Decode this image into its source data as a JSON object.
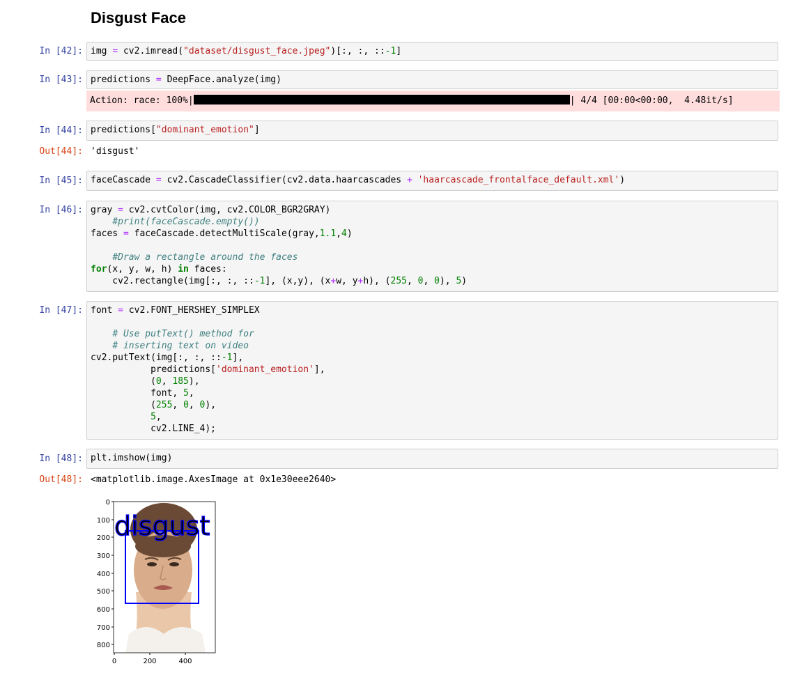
{
  "heading": "Disgust Face",
  "cells": {
    "c42": {
      "prompt": "In [42]:"
    },
    "c43": {
      "prompt": "In [43]:",
      "stderr_prefix": "Action: race: 100%|",
      "stderr_suffix": "| 4/4 [00:00<00:00,  4.48it/s]",
      "progress": 1.0
    },
    "c44": {
      "prompt": "In [44]:",
      "out_prompt": "Out[44]:",
      "out": "'disgust'"
    },
    "c45": {
      "prompt": "In [45]:"
    },
    "c46": {
      "prompt": "In [46]:"
    },
    "c47": {
      "prompt": "In [47]:"
    },
    "c48": {
      "prompt": "In [48]:",
      "out_prompt": "Out[48]:",
      "out": "<matplotlib.image.AxesImage at 0x1e30eee2640>"
    }
  },
  "code_tokens": {
    "c42": [
      [
        [
          "img ",
          ""
        ],
        [
          "=",
          "op"
        ],
        [
          " cv2.imread(",
          ""
        ],
        [
          "\"dataset/disgust_face.jpeg\"",
          "str"
        ],
        [
          ")[:, :, ::",
          ""
        ],
        [
          "-1",
          "num"
        ],
        [
          "]",
          ""
        ]
      ]
    ],
    "c43": [
      [
        [
          "predictions ",
          ""
        ],
        [
          "=",
          "op"
        ],
        [
          " DeepFace.analyze(img)",
          ""
        ]
      ]
    ],
    "c44": [
      [
        [
          "predictions[",
          ""
        ],
        [
          "\"dominant_emotion\"",
          "str"
        ],
        [
          "]",
          ""
        ]
      ]
    ],
    "c45": [
      [
        [
          "faceCascade ",
          ""
        ],
        [
          "=",
          "op"
        ],
        [
          " cv2.CascadeClassifier(cv2.data.haarcascades ",
          ""
        ],
        [
          "+",
          "op"
        ],
        [
          " ",
          ""
        ],
        [
          "'haarcascade_frontalface_default.xml'",
          "str"
        ],
        [
          ")",
          ""
        ]
      ]
    ],
    "c46": [
      [
        [
          "gray ",
          ""
        ],
        [
          "=",
          "op"
        ],
        [
          " cv2.cvtColor(img, cv2.COLOR_BGR2GRAY)",
          ""
        ]
      ],
      [
        [
          "    ",
          ""
        ],
        [
          "#print(faceCascade.empty())",
          "cm"
        ]
      ],
      [
        [
          "faces ",
          ""
        ],
        [
          "=",
          "op"
        ],
        [
          " faceCascade.detectMultiScale(gray,",
          ""
        ],
        [
          "1.1",
          "num"
        ],
        [
          ",",
          ""
        ],
        [
          "4",
          "num"
        ],
        [
          ")",
          ""
        ]
      ],
      [],
      [
        [
          "    ",
          ""
        ],
        [
          "#Draw a rectangle around the faces",
          "cm"
        ]
      ],
      [
        [
          "for",
          "kw"
        ],
        [
          "(x, y, w, h) ",
          ""
        ],
        [
          "in",
          "kw"
        ],
        [
          " faces:",
          ""
        ]
      ],
      [
        [
          "    cv2.rectangle(img[:, :, ::",
          ""
        ],
        [
          "-1",
          "num"
        ],
        [
          "], (x,y), (x",
          ""
        ],
        [
          "+",
          "op"
        ],
        [
          "w, y",
          ""
        ],
        [
          "+",
          "op"
        ],
        [
          "h), (",
          ""
        ],
        [
          "255",
          "num"
        ],
        [
          ", ",
          ""
        ],
        [
          "0",
          "num"
        ],
        [
          ", ",
          ""
        ],
        [
          "0",
          "num"
        ],
        [
          "), ",
          ""
        ],
        [
          "5",
          "num"
        ],
        [
          ")",
          ""
        ]
      ]
    ],
    "c47": [
      [
        [
          "font ",
          ""
        ],
        [
          "=",
          "op"
        ],
        [
          " cv2.FONT_HERSHEY_SIMPLEX",
          ""
        ]
      ],
      [],
      [
        [
          "    ",
          ""
        ],
        [
          "# Use putText() method for",
          "cm"
        ]
      ],
      [
        [
          "    ",
          ""
        ],
        [
          "# inserting text on video",
          "cm"
        ]
      ],
      [
        [
          "cv2.putText(img[:, :, ::",
          ""
        ],
        [
          "-1",
          "num"
        ],
        [
          "],",
          ""
        ]
      ],
      [
        [
          "           predictions[",
          ""
        ],
        [
          "'dominant_emotion'",
          "str"
        ],
        [
          "],",
          ""
        ]
      ],
      [
        [
          "           (",
          ""
        ],
        [
          "0",
          "num"
        ],
        [
          ", ",
          ""
        ],
        [
          "185",
          "num"
        ],
        [
          "),",
          ""
        ]
      ],
      [
        [
          "           font, ",
          ""
        ],
        [
          "5",
          "num"
        ],
        [
          ",",
          ""
        ]
      ],
      [
        [
          "           (",
          ""
        ],
        [
          "255",
          "num"
        ],
        [
          ", ",
          ""
        ],
        [
          "0",
          "num"
        ],
        [
          ", ",
          ""
        ],
        [
          "0",
          "num"
        ],
        [
          "),",
          ""
        ]
      ],
      [
        [
          "           ",
          ""
        ],
        [
          "5",
          "num"
        ],
        [
          ",",
          ""
        ]
      ],
      [
        [
          "           cv2.LINE_4);",
          ""
        ]
      ]
    ],
    "c48": [
      [
        [
          "plt.imshow(img)",
          ""
        ]
      ]
    ]
  },
  "plot": {
    "overlay_text": "disgust",
    "overlay_color": "#0000ff",
    "yticks": [
      "0",
      "100",
      "200",
      "300",
      "400",
      "500",
      "600",
      "700",
      "800"
    ],
    "xticks": [
      "0",
      "200",
      "400"
    ]
  }
}
